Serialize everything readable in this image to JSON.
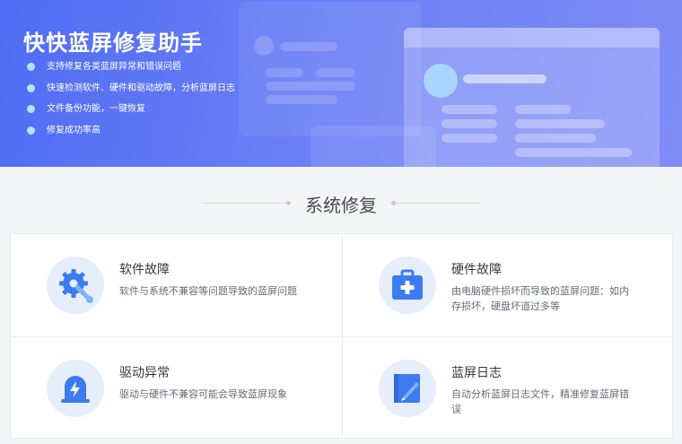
{
  "banner": {
    "title": "快快蓝屏修复助手",
    "features": [
      "支持修复各类蓝屏异常和错误问题",
      "快速检测软件、硬件和驱动故障，分析蓝屏日志",
      "文件备份功能，一键恢复",
      "修复成功率高"
    ]
  },
  "section": {
    "title": "系统修复"
  },
  "cards": [
    {
      "title": "软件故障",
      "desc": "软件与系统不兼容等问题导致的蓝屏问题",
      "icon": "gear-wrench-icon"
    },
    {
      "title": "硬件故障",
      "desc": "由电脑硬件损坏而导致的蓝屏问题：如内存损坏，硬盘坏道过多等",
      "icon": "toolbox-icon"
    },
    {
      "title": "驱动异常",
      "desc": "驱动与硬件不兼容可能会导致蓝屏现象",
      "icon": "lightning-alarm-icon"
    },
    {
      "title": "蓝屏日志",
      "desc": "自动分析蓝屏日志文件，精准修复蓝屏错误",
      "icon": "notebook-pen-icon"
    }
  ],
  "colors": {
    "accent": "#3c7cf0",
    "icon_bg": "#e6eefb",
    "banner_start": "#4f6cf4",
    "banner_end": "#7f8cf6"
  }
}
